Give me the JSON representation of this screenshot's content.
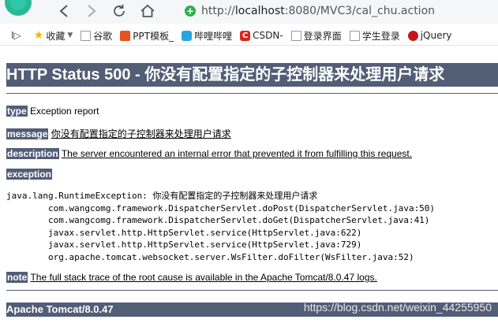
{
  "browser": {
    "url_scheme": "http://",
    "url_host": "localhost",
    "url_path": ":8080/MVC3/cal_chu.action",
    "reader_glyph": "I▷",
    "bookmarks": [
      {
        "label": "收藏",
        "icon": "star-icon"
      },
      {
        "label": "谷歌",
        "icon": "page-icon"
      },
      {
        "label": "PPT模板_",
        "icon": "ppt-icon"
      },
      {
        "label": "哔哩哔哩",
        "icon": "bilibili-icon"
      },
      {
        "label": "CSDN-",
        "icon": "csdn-icon"
      },
      {
        "label": "登录界面",
        "icon": "page-icon"
      },
      {
        "label": "学生登录",
        "icon": "page-icon"
      },
      {
        "label": "jQuery",
        "icon": "jquery-icon"
      }
    ]
  },
  "page": {
    "title": "HTTP Status 500 - 你没有配置指定的子控制器来处理用户请求",
    "type_label": "type",
    "type_value": "Exception report",
    "message_label": "message",
    "message_value": "你没有配置指定的子控制器来处理用户请求",
    "description_label": "description",
    "description_value": "The server encountered an internal error that prevented it from fulfilling this request.",
    "exception_label": "exception",
    "stack_trace": "java.lang.RuntimeException: 你没有配置指定的子控制器来处理用户请求\n\tcom.wangcomg.framework.DispatcherServlet.doPost(DispatcherServlet.java:50)\n\tcom.wangcomg.framework.DispatcherServlet.doGet(DispatcherServlet.java:41)\n\tjavax.servlet.http.HttpServlet.service(HttpServlet.java:622)\n\tjavax.servlet.http.HttpServlet.service(HttpServlet.java:729)\n\torg.apache.tomcat.websocket.server.WsFilter.doFilter(WsFilter.java:52)",
    "note_label": "note",
    "note_value": "The full stack trace of the root cause is available in the Apache Tomcat/8.0.47 logs.",
    "footer": "Apache Tomcat/8.0.47",
    "watermark": "https://blog.csdn.net/weixin_44255950"
  }
}
